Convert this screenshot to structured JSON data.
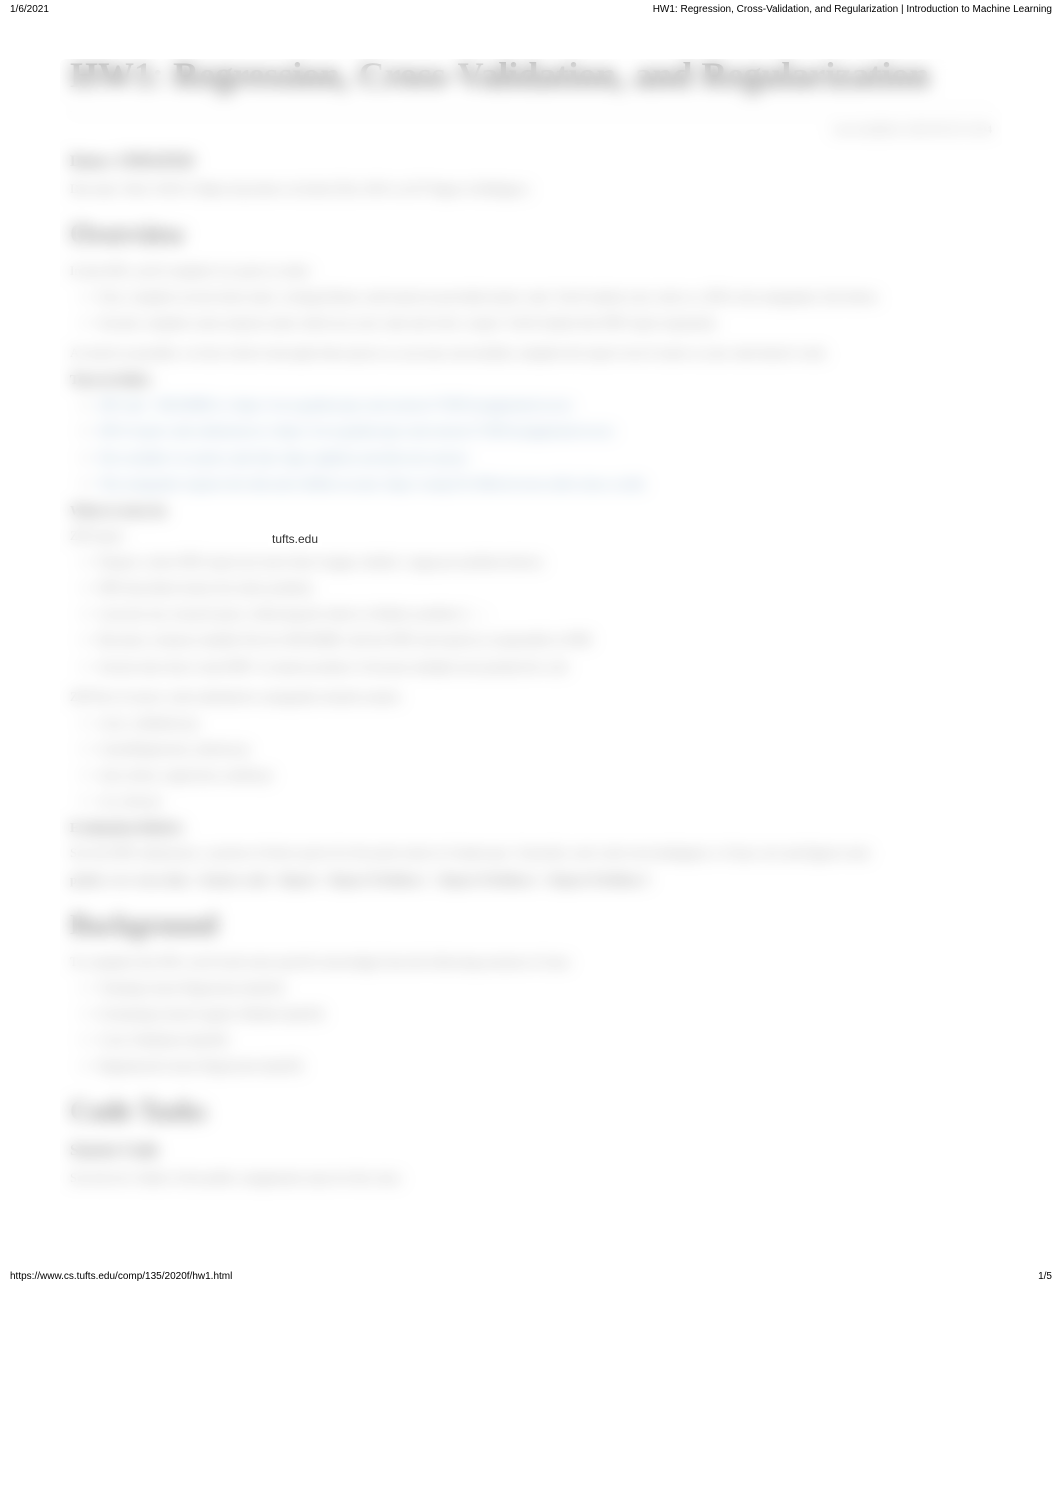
{
  "browser": {
    "date": "1/6/2021",
    "tab_title": "HW1: Regression, Cross-Validation, and Regularization | Introduction to Machine Learning",
    "footer_url": "https://www.cs.tufts.edu/comp/135/2020f/hw1.html",
    "page_indicator": "1/5"
  },
  "page": {
    "title": "HW1: Regression, Cross-Validation, and Regularization",
    "last_modified": "Last modified: 2020-09-29 14:04",
    "dates_heading": "Dates: UPDATED",
    "due_line": "Due date: Wed. 9/30/11:59pm Anywhere on Earth (Thu 10/01 on ET Pages in Halligan.)",
    "overview_heading": "Overview",
    "overview_text": "In this HW, you'll complete two parts in order:",
    "overview_items": [
      "First, complete several short tasks: writing Python code based on provided starter code. You'll submit your code as a ZIP to the autograder, first below.",
      "Second, complete some analysis tasks which use your code and write a report. You'll submit this PDF report separately."
    ],
    "overview_note": "As much as possible, we have tried to decouple these pieces so you may successfully complete the report even if some or your code doesn't work.",
    "turn_in_heading": "Turn-in links:",
    "turn_in_items": [
      "ZIP code + README to: https://www.gradescope.com/courses/173055/assignments/xxxxx",
      "ZIP of report code submission to: https://www.gradescope.com/courses/173055/assignments/xxxxx",
      "File available via starter-code link: https://github.com/tufts-ml-courses/",
      "This autograder requires the tufts.edu GitHub account. https://comp135-20fserver.eecs.tufts-class-cs.tufts"
    ],
    "visible_link_fragment": "tufts.edu",
    "what_to_turn_in_heading": "What to turn in:",
    "zip_heading": "ZIP report",
    "zip_items": [
      "Prepare a short PDF report (no more than 4 pages; ideally 1 page per problem below).",
      "PDF described clearly the entire problem.",
      "Lean doc key research piece, following the rubrics in Rubric problem 2.  →",
      "Becomes a human readable file (it's README with the PDF and report) as responsible in PDF.",
      "Section later that is task-PDF! we please produce it because multiple turn penalty/live call."
    ],
    "zip_note": "ZIP Part of source code submitted to autograder should contain:",
    "zip_files": [
      "cross_validation.py",
      "LinearRegression_sklearn.py",
      "train_linear_regression_model.py",
      "viz_tools.py"
    ],
    "evaluation_heading": "Evaluation Rubric:",
    "evaluation_text": "See the PDF submission, a portion of below given for the point totals in Gradescope. Generally, each code error/ambiguity is 10 pts; text and figures total.",
    "points_line": "points | srv cross data - feature code - Report - Report Problem 1 - Report Problem 2 - Report Problem 3",
    "background_heading": "Background",
    "background_text": "To complete this HW, you'll need some specific knowledge from the following sessions of class:",
    "background_items": [
      "Training Linear Regression (day02)",
      "Evaluating Linear/Logistic Models (day03)",
      "Cross Validation (day04)",
      "Regularized Linear Regression (day05)"
    ],
    "code_tasks_heading": "Code Tasks",
    "starter_code_heading": "Starter Code",
    "starter_code_text": "See the hw1 folder of the public assignments repo for this class:"
  }
}
